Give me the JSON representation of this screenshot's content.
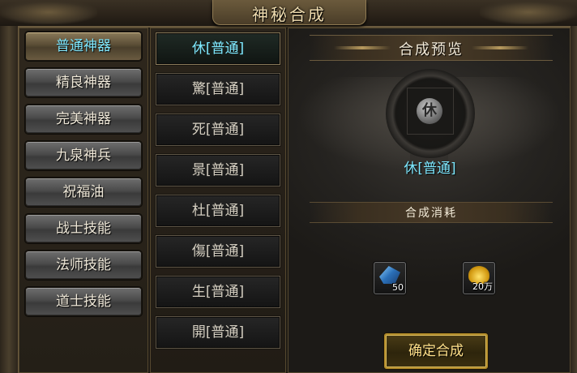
{
  "window": {
    "title": "神秘合成"
  },
  "categories": [
    {
      "label": "普通神器",
      "selected": true
    },
    {
      "label": "精良神器",
      "selected": false
    },
    {
      "label": "完美神器",
      "selected": false
    },
    {
      "label": "九泉神兵",
      "selected": false
    },
    {
      "label": "祝福油",
      "selected": false
    },
    {
      "label": "战士技能",
      "selected": false
    },
    {
      "label": "法师技能",
      "selected": false
    },
    {
      "label": "道士技能",
      "selected": false
    }
  ],
  "items": [
    {
      "label": "休[普通]",
      "selected": true
    },
    {
      "label": "驚[普通]",
      "selected": false
    },
    {
      "label": "死[普通]",
      "selected": false
    },
    {
      "label": "景[普通]",
      "selected": false
    },
    {
      "label": "杜[普通]",
      "selected": false
    },
    {
      "label": "傷[普通]",
      "selected": false
    },
    {
      "label": "生[普通]",
      "selected": false
    },
    {
      "label": "開[普通]",
      "selected": false
    }
  ],
  "preview": {
    "title": "合成预览",
    "result_name": "休[普通]",
    "rune_glyph": "休"
  },
  "cost": {
    "title": "合成消耗",
    "materials": [
      {
        "icon": "crystal-icon",
        "amount": "50"
      },
      {
        "icon": "gold-icon",
        "amount": "20万"
      }
    ]
  },
  "actions": {
    "confirm_label": "确定合成"
  },
  "colors": {
    "selected_text": "#7ee8ff",
    "confirm_text": "#ffe08a",
    "frame_gold": "#b08a2a"
  }
}
